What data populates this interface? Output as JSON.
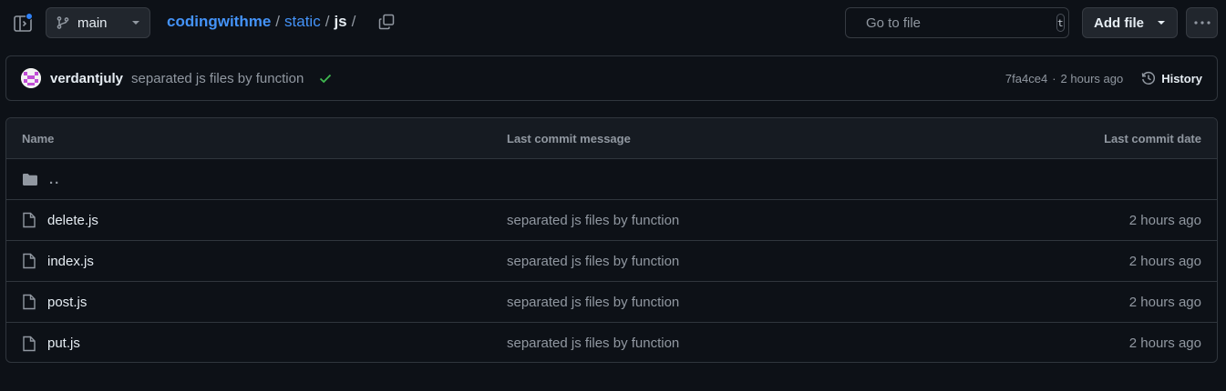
{
  "branch": {
    "name": "main"
  },
  "breadcrumb": {
    "repo": "codingwithme",
    "sep1": "/",
    "folder": "static",
    "sep2": "/",
    "current": "js",
    "sep3": "/"
  },
  "search": {
    "placeholder": "Go to file",
    "shortcut": "t"
  },
  "actions": {
    "add_file": "Add file"
  },
  "commit": {
    "author": "verdantjuly",
    "message": "separated js files by function",
    "hash": "7fa4ce4",
    "separator": "·",
    "time": "2 hours ago",
    "history_label": "History"
  },
  "table": {
    "headers": {
      "name": "Name",
      "message": "Last commit message",
      "date": "Last commit date"
    },
    "parent": "..",
    "files": [
      {
        "name": "delete.js",
        "message": "separated js files by function",
        "date": "2 hours ago"
      },
      {
        "name": "index.js",
        "message": "separated js files by function",
        "date": "2 hours ago"
      },
      {
        "name": "post.js",
        "message": "separated js files by function",
        "date": "2 hours ago"
      },
      {
        "name": "put.js",
        "message": "separated js files by function",
        "date": "2 hours ago"
      }
    ]
  },
  "icons": {
    "sidebar_toggle": "sidebar-expand-icon",
    "branch": "git-branch-icon",
    "copy": "copy-icon",
    "search": "search-icon",
    "more": "kebab-horizontal-icon",
    "history": "history-icon",
    "check": "check-icon",
    "file": "file-icon",
    "folder": "folder-icon"
  },
  "colors": {
    "background": "#0d1117",
    "link": "#4493f8",
    "notification": "#2f81f7",
    "success": "#3fb950",
    "muted": "#9198a1"
  }
}
